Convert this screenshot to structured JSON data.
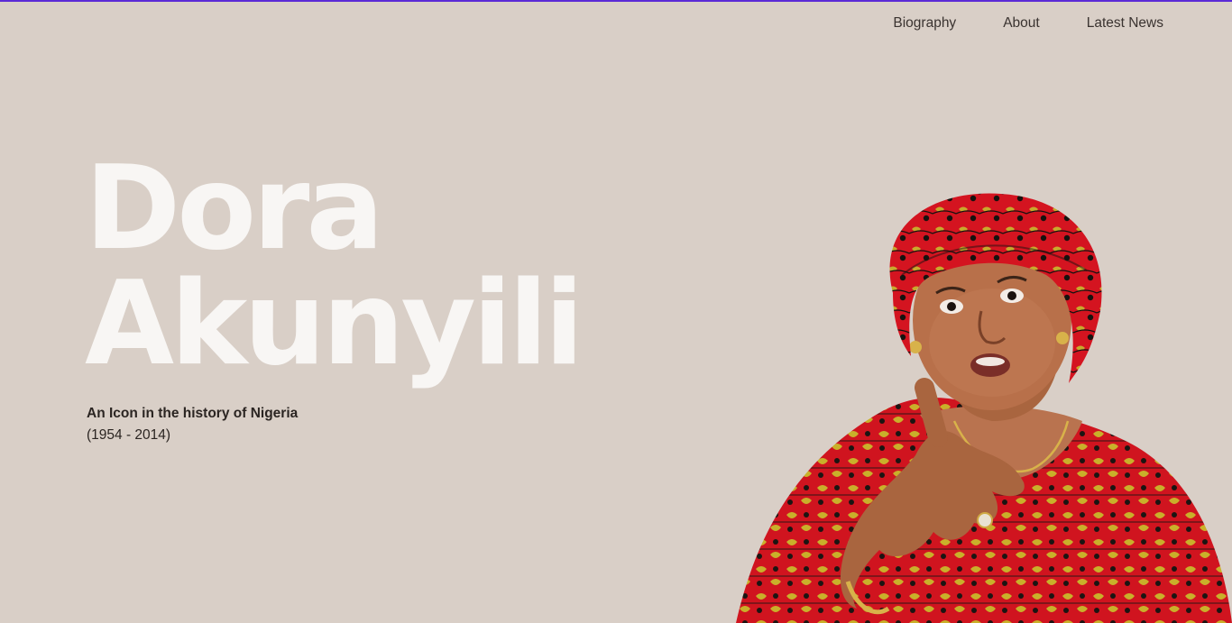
{
  "nav": {
    "items": [
      {
        "label": "Biography"
      },
      {
        "label": "About"
      },
      {
        "label": "Latest News"
      }
    ]
  },
  "hero": {
    "first_name": "Dora",
    "last_name": "Akunyili",
    "tagline": "An Icon in the history of Nigeria",
    "years": "(1954 - 2014)"
  },
  "colors": {
    "background": "#d9cfc7",
    "accent_bar": "#5b2ad6",
    "title_text": "#f8f6f4",
    "nav_text": "#3a3330",
    "headwrap_red": "#d0141f",
    "dress_pattern_yellow": "#c9b02a"
  }
}
